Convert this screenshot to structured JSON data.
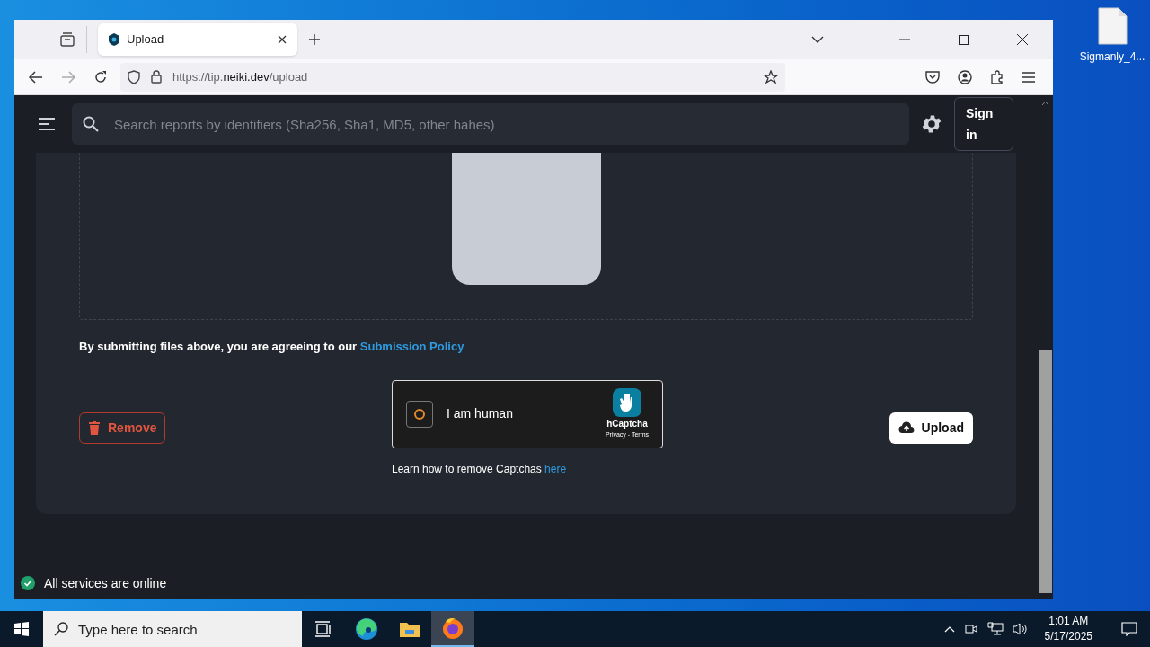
{
  "desktop": {
    "icons": [
      {
        "label": "Sigmanly_4..."
      }
    ]
  },
  "browser": {
    "tabs": [
      {
        "title": "Upload",
        "selected": true
      }
    ],
    "url": {
      "scheme": "https://tip.",
      "domain": "neiki.dev",
      "path": "/upload"
    }
  },
  "page": {
    "search": {
      "placeholder": "Search reports by identifiers (Sha256, Sha1, MD5, other hahes)"
    },
    "sign_in": "Sign in",
    "policy": {
      "text": "By submitting files above, you are agreeing to our",
      "link": "Submission Policy"
    },
    "remove": "Remove",
    "captcha": {
      "loading": true,
      "label": "I am human",
      "brand": "hCaptcha",
      "links": "Privacy - Terms"
    },
    "captcha_help": {
      "text": "Learn how to remove Captchas",
      "link": "here"
    },
    "upload": "Upload",
    "status": {
      "text": "All services are online",
      "color": "#22a06b"
    }
  },
  "taskbar": {
    "search_placeholder": "Type here to search",
    "apps": [
      {
        "kind": "taskview",
        "selected": false
      },
      {
        "kind": "edge",
        "selected": false
      },
      {
        "kind": "folder",
        "selected": false
      },
      {
        "kind": "firefox",
        "selected": true
      }
    ],
    "time": "1:01 AM",
    "date": "5/17/2025"
  }
}
